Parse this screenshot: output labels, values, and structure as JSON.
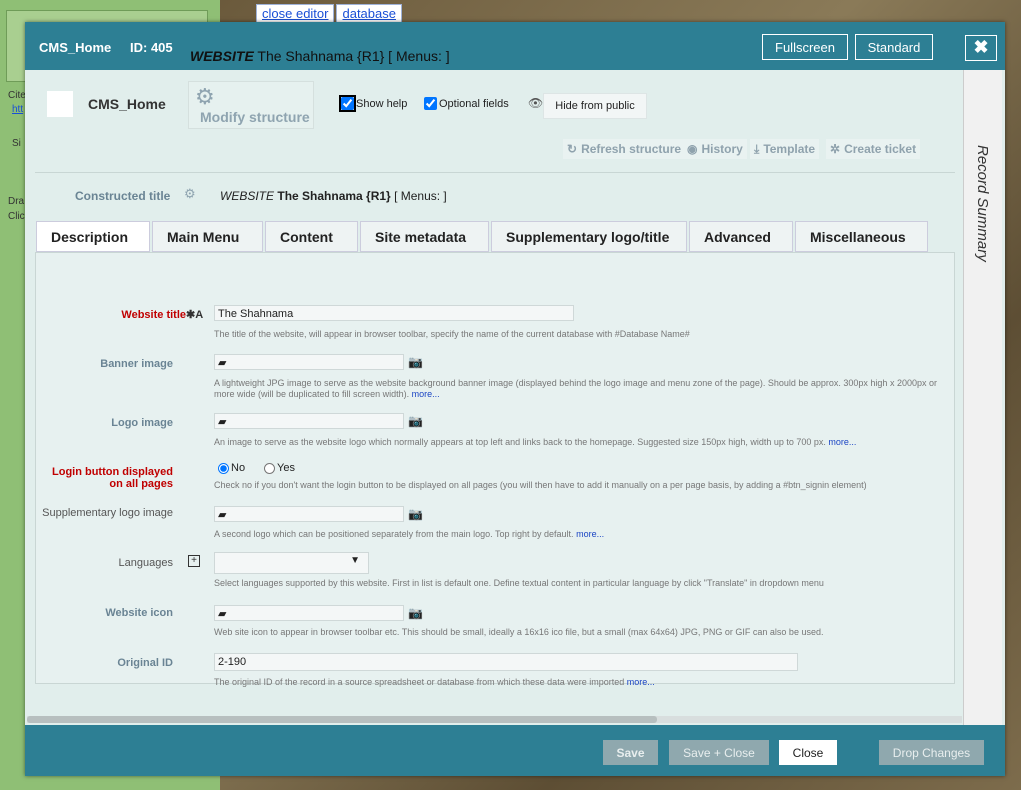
{
  "background": {
    "links": [
      "close editor",
      "database"
    ],
    "fragments": [
      "Cite",
      "htt",
      "Si",
      "Dra",
      "Clic"
    ]
  },
  "titlebar": {
    "app_name": "CMS_Home",
    "id_label": "ID: 405",
    "record_type": "WEBSITE",
    "record_title": "The Shahnama {R1} [ Menus: ]",
    "fullscreen_label": "Fullscreen",
    "standard_label": "Standard",
    "close_symbol": "✖"
  },
  "header": {
    "record_name": "CMS_Home",
    "modify_structure_label": "Modify structure",
    "show_help_label": "Show help",
    "optional_fields_label": "Optional fields",
    "hide_public_label": "Hide from public",
    "actions": [
      "Refresh structure",
      "History",
      "Template",
      "Create ticket"
    ]
  },
  "constructed": {
    "label": "Constructed title",
    "type": "WEBSITE",
    "value": "The Shahnama {R1}",
    "suffix": "[ Menus: ]"
  },
  "tabs": [
    "Description",
    "Main Menu",
    "Content",
    "Site metadata",
    "Supplementary logo/title",
    "Advanced",
    "Miscellaneous"
  ],
  "fields": {
    "website_title": {
      "label": "Website title",
      "value": "The Shahnama",
      "help": "The title of the website, will appear in browser toolbar, specify the name of the current database with #Database Name#"
    },
    "banner_image": {
      "label": "Banner image",
      "help": "A lightweight JPG image to serve as the website background banner image (displayed behind the logo image and menu zone of the page). Should be approx. 300px high x 2000px or more wide (will be duplicated to fill screen width).",
      "more": "more..."
    },
    "logo_image": {
      "label": "Logo image",
      "help": "An image to serve as the website logo which normally appears at top left and links back to the homepage. Suggested size 150px high, width up to 700 px.",
      "more": "more..."
    },
    "login_button": {
      "label_line1": "Login button displayed",
      "label_line2": "on all pages",
      "option_no": "No",
      "option_yes": "Yes",
      "help": "Check no if you don't want the login button to be displayed on all pages (you will then have to add it manually on a per page basis, by adding a #btn_signin element)"
    },
    "supp_logo": {
      "label": "Supplementary logo image",
      "help": "A second logo which can be positioned separately from the main logo. Top right by default.",
      "more": "more..."
    },
    "languages": {
      "label": "Languages",
      "help": "Select languages supported by this website. First in list is default one. Define textual content in particular language by click \"Translate\" in dropdown menu"
    },
    "website_icon": {
      "label": "Website icon",
      "help": "Web site icon to appear in browser toolbar etc. This should be small, ideally a 16x16 ico file, but a small (max 64x64) JPG, PNG or GIF can also be used."
    },
    "original_id": {
      "label": "Original ID",
      "value": "2-190",
      "help": "The original ID of the record in a source spreadsheet or database from which these data were imported",
      "more": "more..."
    }
  },
  "summary_label": "Record Summary",
  "footer": {
    "save": "Save",
    "save_close": "Save + Close",
    "close": "Close",
    "drop": "Drop Changes"
  },
  "colors": {
    "titlebar": "#2d7f94",
    "required_label": "#c00000",
    "field_label": "#6a8494",
    "more_link": "#1c46c4"
  }
}
